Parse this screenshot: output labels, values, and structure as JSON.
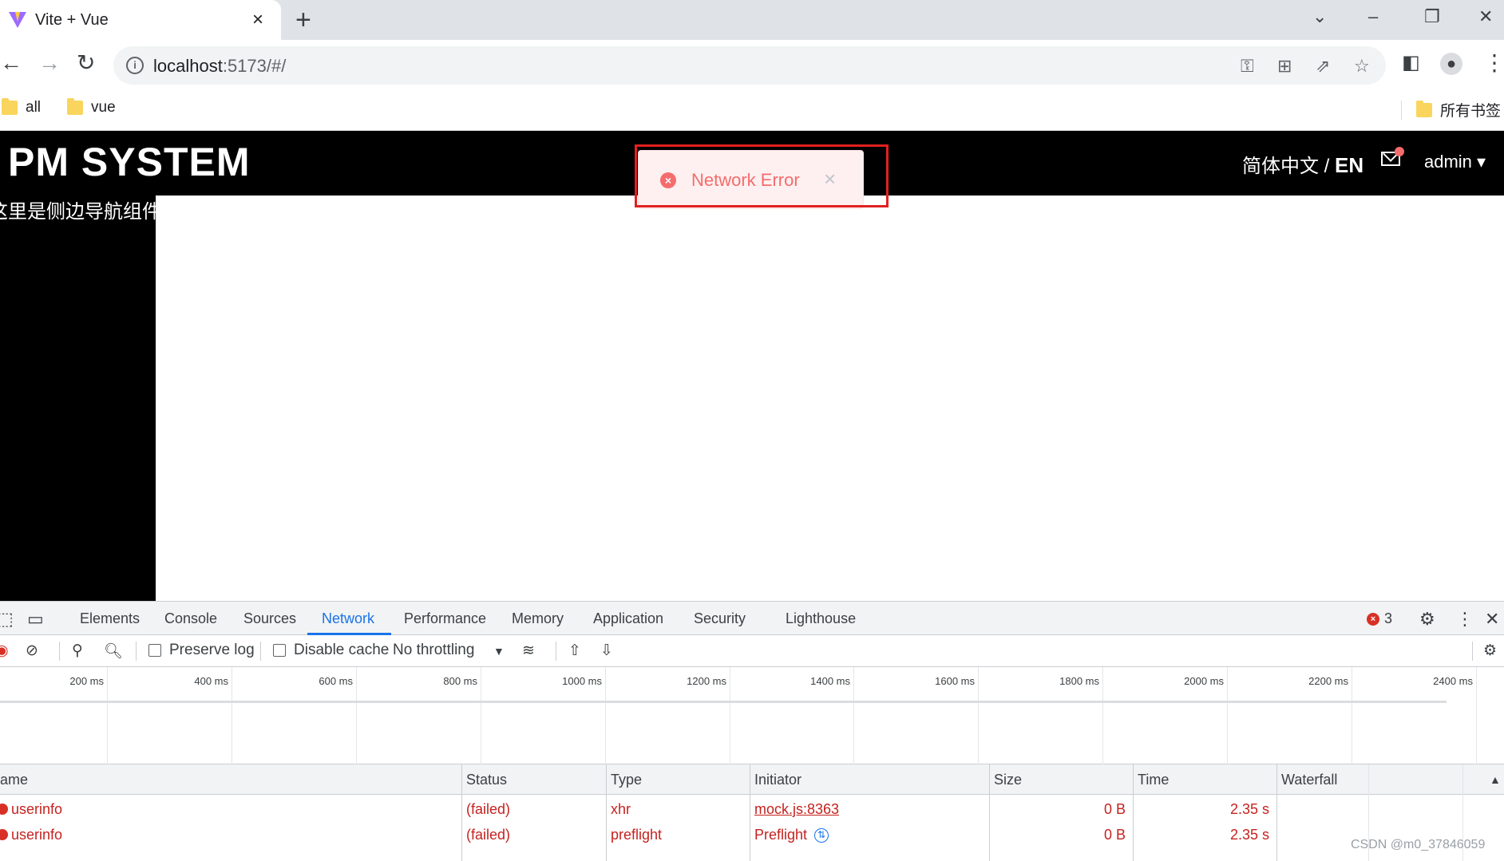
{
  "browser": {
    "tab_title": "Vite + Vue",
    "url_host": "localhost",
    "url_rest": ":5173/#/",
    "bookmarks": [
      "all",
      "vue"
    ],
    "all_bookmarks": "所有书签"
  },
  "app": {
    "brand": "PM SYSTEM",
    "lang_zh": "简体中文 / ",
    "lang_en": "EN",
    "user": "admin",
    "sidebar_text": "这里是侧边导航组件",
    "toast": {
      "message": "Network Error"
    }
  },
  "devtools": {
    "tabs": [
      "Elements",
      "Console",
      "Sources",
      "Network",
      "Performance",
      "Memory",
      "Application",
      "Security",
      "Lighthouse"
    ],
    "active_tab": "Network",
    "error_count": "3",
    "toolbar": {
      "preserve_log": "Preserve log",
      "disable_cache": "Disable cache",
      "throttling": "No throttling"
    },
    "timeline_ticks": [
      "200 ms",
      "400 ms",
      "600 ms",
      "800 ms",
      "1000 ms",
      "1200 ms",
      "1400 ms",
      "1600 ms",
      "1800 ms",
      "2000 ms",
      "2200 ms",
      "2400 ms"
    ],
    "columns": [
      "ame",
      "Status",
      "Type",
      "Initiator",
      "Size",
      "Time",
      "Waterfall"
    ],
    "rows": [
      {
        "name": "userinfo",
        "status": "(failed)",
        "type": "xhr",
        "initiator": "mock.js:8363",
        "size": "0 B",
        "time": "2.35 s"
      },
      {
        "name": "userinfo",
        "status": "(failed)",
        "type": "preflight",
        "initiator": "Preflight",
        "size": "0 B",
        "time": "2.35 s"
      }
    ]
  },
  "watermark": "CSDN @m0_37846059",
  "colors": {
    "error": "#c5221f",
    "accent": "#1a73e8",
    "toast_text": "#f56c6c"
  }
}
